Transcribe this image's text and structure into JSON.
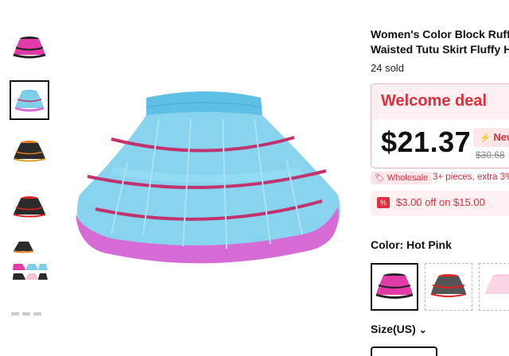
{
  "product": {
    "title_line1": "Women's Color Block Ruff",
    "title_line2": "Waisted Tutu Skirt Fluffy H",
    "sold": "24 sold"
  },
  "deal": {
    "heading": "Welcome deal",
    "price": "$21.37",
    "badge": "New",
    "original_price": "$30.68"
  },
  "wholesale": {
    "tag": "Wholesale",
    "text": "3+ pieces, extra 3%"
  },
  "coupon": {
    "text": "$3.00 off on $15.00"
  },
  "color": {
    "label": "Color: Hot Pink"
  },
  "size": {
    "label": "Size(US)",
    "chevron": "⌄"
  },
  "colors": {
    "accent": "#e02e3d",
    "accent_bg": "#fff0f1",
    "tutu_blue": "#7fcfe9",
    "tutu_pink": "#d66bd6"
  },
  "icons": [
    "tag-icon",
    "bolt-icon",
    "coupon-icon",
    "chevron-down-icon"
  ]
}
